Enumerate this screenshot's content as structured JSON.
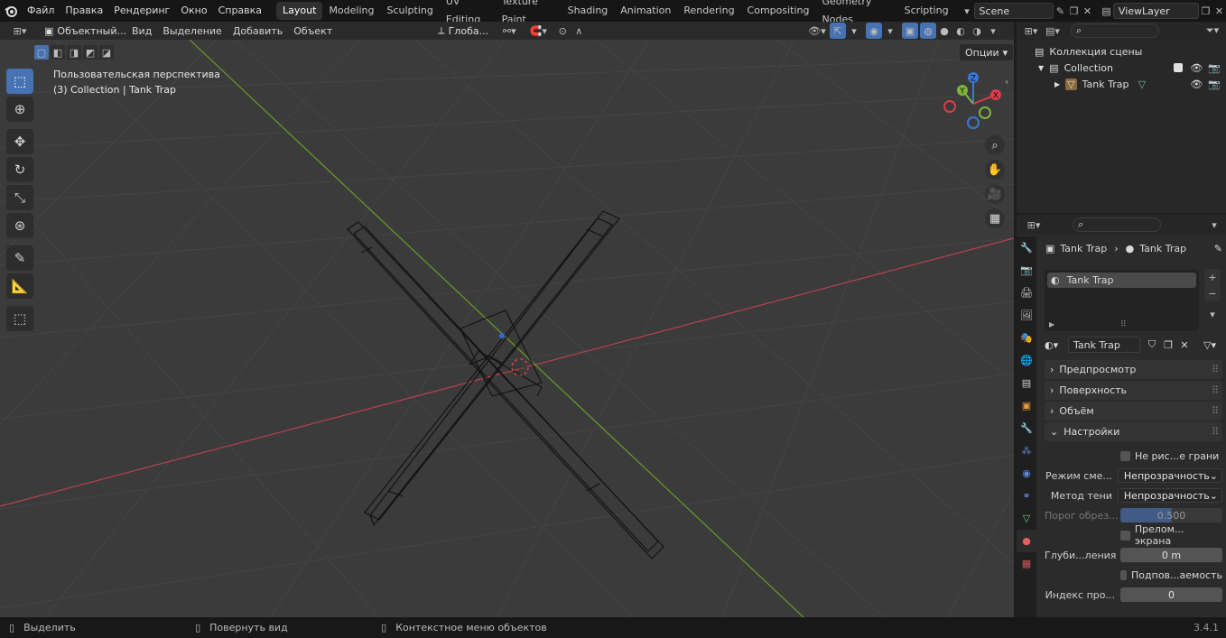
{
  "topbar": {
    "menus": [
      "Файл",
      "Правка",
      "Рендеринг",
      "Окно",
      "Справка"
    ],
    "workspaces": [
      "Layout",
      "Modeling",
      "Sculpting",
      "UV Editing",
      "Texture Paint",
      "Shading",
      "Animation",
      "Rendering",
      "Compositing",
      "Geometry Nodes",
      "Scripting"
    ],
    "active_workspace": "Layout",
    "scene": "Scene",
    "view_layer": "ViewLayer"
  },
  "viewport_header": {
    "mode": "Объектный...",
    "menus": [
      "Вид",
      "Выделение",
      "Добавить",
      "Объект"
    ],
    "transform_orientation": "Глоба...",
    "options_label": "Опции"
  },
  "viewport": {
    "perspective_label": "Пользовательская перспектива",
    "collection_label": "(3) Collection | Tank Trap",
    "gizmo": {
      "z": "Z",
      "y": "Y",
      "x": "X"
    }
  },
  "outliner": {
    "root": "Коллекция сцены",
    "collection": "Collection",
    "object": "Tank Trap"
  },
  "properties": {
    "breadcrumb_object": "Tank Trap",
    "breadcrumb_material": "Tank Trap",
    "slot": "Tank Trap",
    "material_name": "Tank Trap",
    "panels": [
      "Предпросмотр",
      "Поверхность",
      "Объём",
      "Настройки"
    ],
    "settings": {
      "backface": "Не рис...е грани",
      "blend_label": "Режим сме...",
      "blend_value": "Непрозрачность",
      "shadow_label": "Метод тени",
      "shadow_value": "Непрозрачность",
      "clip_label": "Порог обрез...",
      "clip_value": "0.500",
      "refraction": "Прелом... экрана",
      "depth_label": "Глуби...ления",
      "depth_value": "0 m",
      "sss": "Подпов...аемость",
      "pass_label": "Индекс про...",
      "pass_value": "0"
    }
  },
  "statusbar": {
    "select": "Выделить",
    "rotate": "Повернуть вид",
    "context": "Контекстное меню объектов",
    "version": "3.4.1"
  },
  "colors": {
    "accent": "#4772b3",
    "x_axis": "#b5424b",
    "y_axis": "#6a9b2a",
    "gizmo_z": "#3b78d6",
    "gizmo_y": "#7fb53c",
    "gizmo_x": "#e03a4b"
  }
}
